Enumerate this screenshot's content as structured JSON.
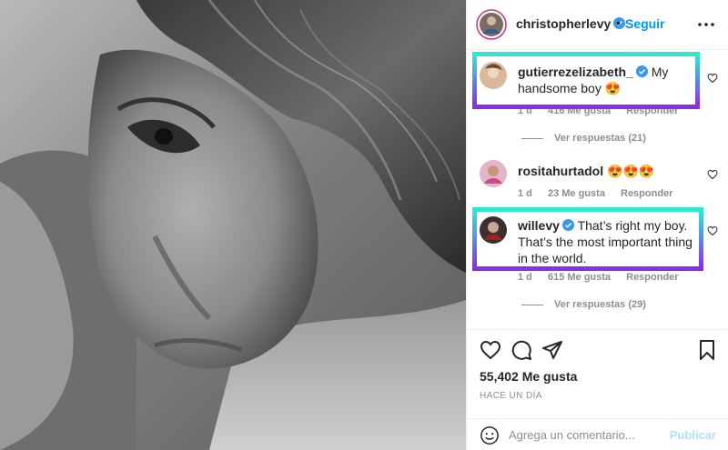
{
  "post": {
    "author": "christopherlevy",
    "dot": "•",
    "follow_label": "Seguir",
    "more_icon": "more-horizontal-icon"
  },
  "comments": [
    {
      "user": "gutierrezelizabeth_",
      "text": "My handsome boy 😍",
      "time": "1 d",
      "likes": "416 Me gusta",
      "reply": "Responder",
      "view_replies": "Ver respuestas (21)",
      "highlighted": true
    },
    {
      "user": "rositahurtadol",
      "text": "😍😍😍",
      "time": "1 d",
      "likes": "23 Me gusta",
      "reply": "Responder",
      "highlighted": false
    },
    {
      "user": "willevy",
      "text": "That’s right my boy. That’s the most important thing in the world.",
      "time": "1 d",
      "likes": "615 Me gusta",
      "reply": "Responder",
      "view_replies": "Ver respuestas (29)",
      "highlighted": true
    }
  ],
  "actions": {
    "like_icon": "heart-icon",
    "comment_icon": "comment-icon",
    "share_icon": "send-icon",
    "save_icon": "bookmark-icon"
  },
  "likes_label": "55,402 Me gusta",
  "time_ago": "HACE UN DÍA",
  "comment_box": {
    "placeholder": "Agrega un comentario...",
    "post_label": "Publicar"
  },
  "colors": {
    "accent": "#0095f6",
    "highlight_top": "#2ee8d2",
    "highlight_bottom": "#8c2ce8",
    "verified": "#3897f0"
  }
}
